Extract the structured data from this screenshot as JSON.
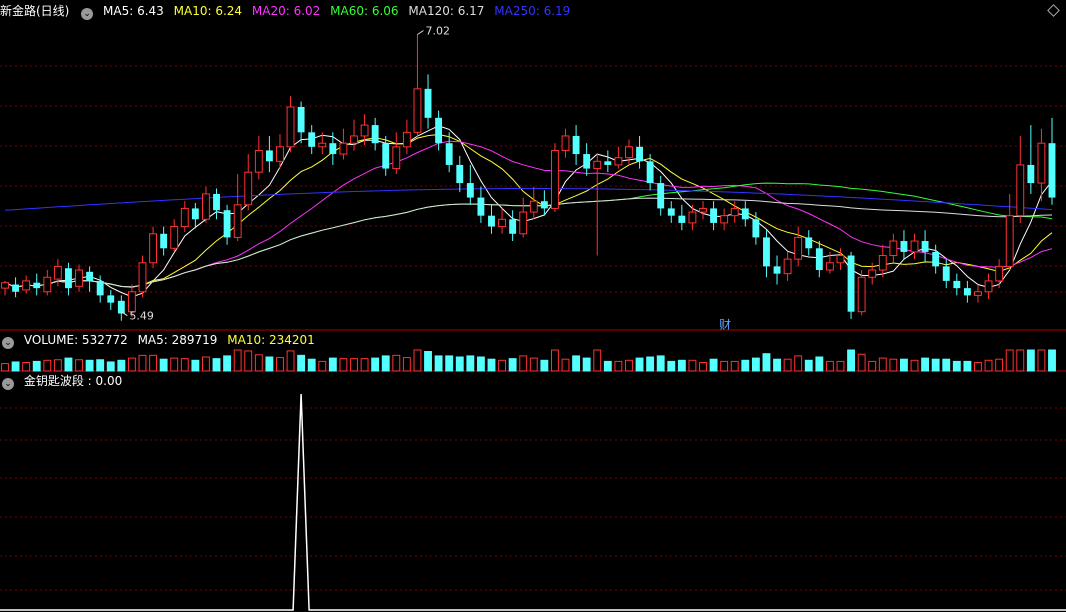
{
  "header": {
    "title": "新金路(日线)",
    "ma": [
      {
        "label": "MA5: 6.43",
        "color": "#ffffff"
      },
      {
        "label": "MA10: 6.24",
        "color": "#ffff33"
      },
      {
        "label": "MA20: 6.02",
        "color": "#ff33ff"
      },
      {
        "label": "MA60: 6.06",
        "color": "#33ff33"
      },
      {
        "label": "MA120: 6.17",
        "color": "#dddddd"
      },
      {
        "label": "MA250: 6.19",
        "color": "#3333ff"
      }
    ]
  },
  "volume_legend": {
    "title": "VOLUME: 532772",
    "ma5": "MA5: 289719",
    "ma10": "MA10: 234201"
  },
  "indicator_legend": {
    "title": "金钥匙波段 : 0.00"
  },
  "annotations": {
    "high_label": "7.02",
    "low_label": "5.49",
    "cai_marker": "财"
  },
  "colors": {
    "up": "#ff3232",
    "down": "#54ffff",
    "grid": "#7a0000",
    "separator": "#b00000"
  },
  "chart_data": {
    "type": "candlestick",
    "title": "新金路(日线)",
    "price_high": 7.02,
    "price_low": 5.49,
    "candles": [
      [
        5.62,
        5.65,
        5.58,
        5.66
      ],
      [
        5.64,
        5.6,
        5.57,
        5.68
      ],
      [
        5.61,
        5.66,
        5.59,
        5.69
      ],
      [
        5.65,
        5.62,
        5.58,
        5.7
      ],
      [
        5.6,
        5.68,
        5.58,
        5.72
      ],
      [
        5.67,
        5.74,
        5.63,
        5.78
      ],
      [
        5.73,
        5.62,
        5.58,
        5.76
      ],
      [
        5.63,
        5.72,
        5.6,
        5.75
      ],
      [
        5.71,
        5.66,
        5.6,
        5.74
      ],
      [
        5.66,
        5.58,
        5.54,
        5.69
      ],
      [
        5.58,
        5.54,
        5.5,
        5.61
      ],
      [
        5.55,
        5.48,
        5.44,
        5.58
      ],
      [
        5.49,
        5.6,
        5.46,
        5.64
      ],
      [
        5.6,
        5.76,
        5.57,
        5.8
      ],
      [
        5.76,
        5.92,
        5.73,
        5.96
      ],
      [
        5.92,
        5.84,
        5.8,
        5.96
      ],
      [
        5.84,
        5.96,
        5.82,
        6.0
      ],
      [
        5.96,
        6.06,
        5.93,
        6.1
      ],
      [
        6.06,
        6.0,
        5.95,
        6.09
      ],
      [
        6.0,
        6.14,
        5.98,
        6.18
      ],
      [
        6.14,
        6.05,
        6.0,
        6.17
      ],
      [
        6.05,
        5.9,
        5.86,
        6.08
      ],
      [
        5.9,
        6.08,
        5.88,
        6.25
      ],
      [
        6.08,
        6.26,
        6.05,
        6.36
      ],
      [
        6.26,
        6.38,
        6.22,
        6.46
      ],
      [
        6.38,
        6.32,
        6.26,
        6.46
      ],
      [
        6.32,
        6.4,
        6.28,
        6.47
      ],
      [
        6.4,
        6.62,
        6.37,
        6.68
      ],
      [
        6.62,
        6.48,
        6.42,
        6.65
      ],
      [
        6.48,
        6.4,
        6.36,
        6.52
      ],
      [
        6.4,
        6.42,
        6.36,
        6.48
      ],
      [
        6.42,
        6.36,
        6.3,
        6.48
      ],
      [
        6.36,
        6.42,
        6.33,
        6.5
      ],
      [
        6.42,
        6.46,
        6.38,
        6.55
      ],
      [
        6.46,
        6.52,
        6.41,
        6.58
      ],
      [
        6.52,
        6.42,
        6.38,
        6.56
      ],
      [
        6.42,
        6.28,
        6.24,
        6.46
      ],
      [
        6.28,
        6.4,
        6.25,
        6.48
      ],
      [
        6.4,
        6.48,
        6.36,
        6.55
      ],
      [
        6.48,
        6.72,
        6.45,
        7.02
      ],
      [
        6.72,
        6.56,
        6.5,
        6.8
      ],
      [
        6.56,
        6.42,
        6.38,
        6.6
      ],
      [
        6.42,
        6.3,
        6.26,
        6.48
      ],
      [
        6.3,
        6.2,
        6.15,
        6.35
      ],
      [
        6.2,
        6.12,
        6.08,
        6.3
      ],
      [
        6.12,
        6.02,
        5.98,
        6.18
      ],
      [
        6.02,
        5.96,
        5.92,
        6.08
      ],
      [
        5.96,
        6.0,
        5.92,
        6.06
      ],
      [
        6.0,
        5.92,
        5.88,
        6.05
      ],
      [
        5.92,
        6.04,
        5.9,
        6.12
      ],
      [
        6.04,
        6.1,
        6.0,
        6.18
      ],
      [
        6.1,
        6.06,
        6.02,
        6.16
      ],
      [
        6.06,
        6.38,
        6.04,
        6.42
      ],
      [
        6.38,
        6.46,
        6.34,
        6.5
      ],
      [
        6.46,
        6.36,
        6.3,
        6.52
      ],
      [
        6.36,
        6.28,
        6.24,
        6.42
      ],
      [
        6.28,
        6.32,
        5.8,
        6.36
      ],
      [
        6.32,
        6.3,
        6.26,
        6.38
      ],
      [
        6.3,
        6.34,
        6.28,
        6.4
      ],
      [
        6.34,
        6.4,
        6.3,
        6.44
      ],
      [
        6.4,
        6.32,
        6.28,
        6.46
      ],
      [
        6.32,
        6.2,
        6.16,
        6.36
      ],
      [
        6.2,
        6.06,
        6.02,
        6.24
      ],
      [
        6.06,
        6.02,
        5.98,
        6.1
      ],
      [
        6.02,
        5.98,
        5.94,
        6.08
      ],
      [
        5.98,
        6.04,
        5.94,
        6.08
      ],
      [
        6.04,
        6.06,
        6.0,
        6.1
      ],
      [
        6.06,
        5.98,
        5.94,
        6.1
      ],
      [
        5.98,
        6.02,
        5.94,
        6.06
      ],
      [
        6.02,
        6.06,
        5.98,
        6.1
      ],
      [
        6.06,
        6.0,
        5.96,
        6.1
      ],
      [
        6.0,
        5.9,
        5.86,
        6.04
      ],
      [
        5.9,
        5.74,
        5.68,
        5.94
      ],
      [
        5.74,
        5.7,
        5.64,
        5.8
      ],
      [
        5.7,
        5.78,
        5.66,
        5.82
      ],
      [
        5.78,
        5.9,
        5.74,
        5.96
      ],
      [
        5.9,
        5.84,
        5.8,
        5.94
      ],
      [
        5.84,
        5.72,
        5.68,
        5.88
      ],
      [
        5.72,
        5.76,
        5.7,
        5.82
      ],
      [
        5.76,
        5.8,
        5.72,
        5.84
      ],
      [
        5.8,
        5.49,
        5.45,
        5.82
      ],
      [
        5.49,
        5.68,
        5.47,
        5.72
      ],
      [
        5.68,
        5.72,
        5.64,
        5.76
      ],
      [
        5.72,
        5.8,
        5.68,
        5.86
      ],
      [
        5.8,
        5.88,
        5.76,
        5.92
      ],
      [
        5.88,
        5.82,
        5.78,
        5.94
      ],
      [
        5.82,
        5.88,
        5.78,
        5.92
      ],
      [
        5.88,
        5.82,
        5.76,
        5.94
      ],
      [
        5.82,
        5.74,
        5.7,
        5.86
      ],
      [
        5.74,
        5.66,
        5.62,
        5.78
      ],
      [
        5.66,
        5.62,
        5.58,
        5.7
      ],
      [
        5.62,
        5.58,
        5.54,
        5.66
      ],
      [
        5.58,
        5.6,
        5.54,
        5.64
      ],
      [
        5.6,
        5.66,
        5.56,
        5.7
      ],
      [
        5.66,
        5.74,
        5.62,
        5.78
      ],
      [
        5.74,
        6.02,
        5.72,
        6.14
      ],
      [
        6.02,
        6.3,
        5.98,
        6.46
      ],
      [
        6.3,
        6.2,
        6.14,
        6.52
      ],
      [
        6.2,
        6.42,
        6.1,
        6.5
      ],
      [
        6.42,
        6.12,
        6.08,
        6.56
      ]
    ],
    "volume": [],
    "indicator_peak": {
      "value": 1,
      "index": 28
    }
  }
}
